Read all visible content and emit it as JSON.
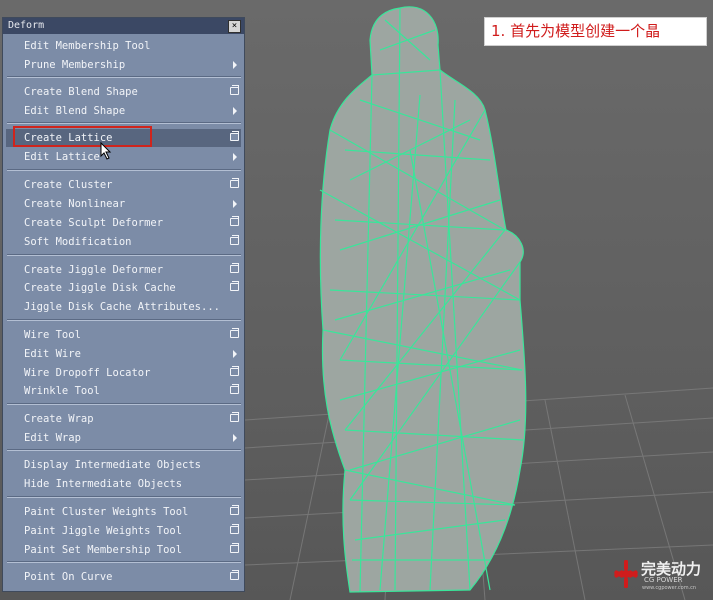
{
  "menu": {
    "title": "Deform",
    "close_glyph": "×",
    "items": [
      {
        "label": "Edit Membership Tool",
        "suffix": "none"
      },
      {
        "label": "Prune Membership",
        "suffix": "arrow"
      },
      {
        "label": "Create Blend Shape",
        "suffix": "option-box"
      },
      {
        "label": "Edit Blend Shape",
        "suffix": "arrow"
      },
      {
        "label": "Create Lattice",
        "suffix": "option-box",
        "highlighted": true
      },
      {
        "label": "Edit Lattice",
        "suffix": "arrow"
      },
      {
        "label": "Create Cluster",
        "suffix": "option-box"
      },
      {
        "label": "Create Nonlinear",
        "suffix": "arrow"
      },
      {
        "label": "Create Sculpt Deformer",
        "suffix": "option-box"
      },
      {
        "label": "Soft Modification",
        "suffix": "option-box"
      },
      {
        "label": "Create Jiggle Deformer",
        "suffix": "option-box"
      },
      {
        "label": "Create Jiggle Disk Cache",
        "suffix": "option-box"
      },
      {
        "label": "Jiggle Disk Cache Attributes...",
        "suffix": "none"
      },
      {
        "label": "Wire Tool",
        "suffix": "option-box"
      },
      {
        "label": "Edit Wire",
        "suffix": "arrow"
      },
      {
        "label": "Wire Dropoff Locator",
        "suffix": "option-box"
      },
      {
        "label": "Wrinkle Tool",
        "suffix": "option-box"
      },
      {
        "label": "Create Wrap",
        "suffix": "option-box"
      },
      {
        "label": "Edit Wrap",
        "suffix": "arrow"
      },
      {
        "label": "Display Intermediate Objects",
        "suffix": "none"
      },
      {
        "label": "Hide Intermediate Objects",
        "suffix": "none"
      },
      {
        "label": "Paint Cluster Weights Tool",
        "suffix": "option-box"
      },
      {
        "label": "Paint Jiggle Weights Tool",
        "suffix": "option-box"
      },
      {
        "label": "Paint Set Membership Tool",
        "suffix": "option-box"
      },
      {
        "label": "Point On Curve",
        "suffix": "option-box"
      }
    ]
  },
  "annotation": {
    "text": "1. 首先为模型创建一个晶",
    "color": "#d01c1c"
  },
  "logo": {
    "brand": "完美动力",
    "sub": "CG POWER",
    "url": "www.cgpower.com.cn",
    "color": "#d01c1c"
  },
  "colors": {
    "menu_bg": "#7c8ca7",
    "menu_title_bg": "#3b4864",
    "highlight": "#58667f",
    "wireframe": "#39e69a",
    "callout_border": "#d0241c"
  }
}
